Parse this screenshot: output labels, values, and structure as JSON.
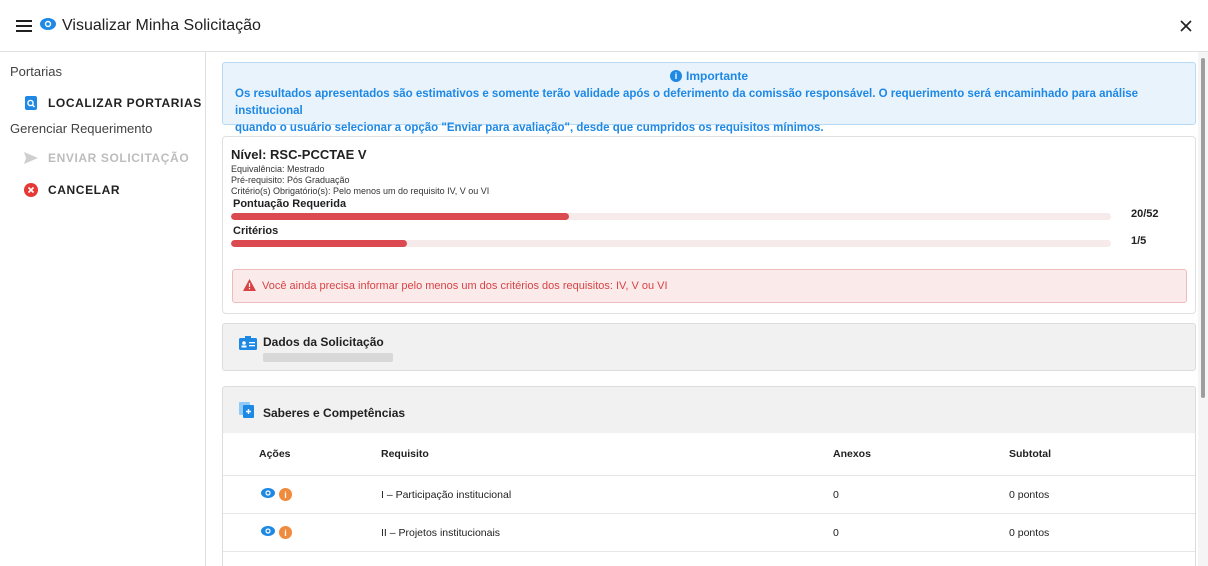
{
  "header": {
    "title": "Visualizar Minha Solicitação"
  },
  "sidebar": {
    "section1": "Portarias",
    "localizar": "LOCALIZAR PORTARIAS",
    "section2": "Gerenciar Requerimento",
    "enviar": "ENVIAR SOLICITAÇÃO",
    "cancelar": "CANCELAR"
  },
  "info_alert": {
    "heading": "Importante",
    "line1": "Os resultados apresentados são estimativos e somente terão validade após o deferimento da comissão responsável. O requerimento será encaminhado para análise institucional",
    "line2": "quando o usuário selecionar a opção \"Enviar para avaliação\", desde que cumpridos os requisitos mínimos."
  },
  "nivel": {
    "title": "Nível: RSC-PCCTAE V",
    "equivalencia": "Equivalência: Mestrado",
    "prerequisito": "Pré-requisito: Pós Graduação",
    "criterios_obrig": "Critério(s) Obrigatório(s): Pelo menos um do requisito IV, V ou VI",
    "pontuacao_label": "Pontuação Requerida",
    "pontuacao_value": "20/52",
    "pontuacao_fraction": 0.3846,
    "criterios_label": "Critérios",
    "criterios_value": "1/5",
    "criterios_fraction": 0.2,
    "error": "Você ainda precisa informar pelo menos um dos critérios dos requisitos: IV, V ou VI"
  },
  "dados": {
    "title": "Dados da Solicitação"
  },
  "saberes": {
    "title": "Saberes e Competências"
  },
  "table": {
    "headers": [
      "Ações",
      "Requisito",
      "Anexos",
      "Subtotal"
    ],
    "rows": [
      {
        "requisito": "I – Participação institucional",
        "anexos": "0",
        "subtotal": "0 pontos"
      },
      {
        "requisito": "II – Projetos institucionais",
        "anexos": "0",
        "subtotal": "0 pontos"
      }
    ]
  },
  "colors": {
    "accent": "#1e88e5",
    "danger": "#db4a50",
    "warning": "#f08a3c"
  }
}
